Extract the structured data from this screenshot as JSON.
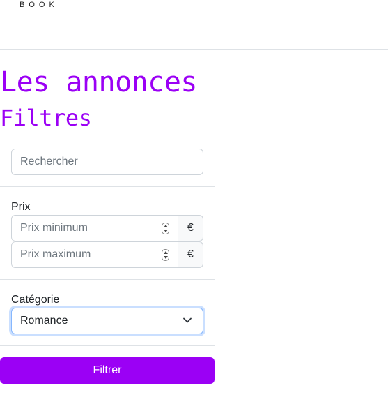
{
  "brand": {
    "text": "BOOK"
  },
  "page": {
    "title": "Les annonces",
    "filters_title": "Filtres"
  },
  "search": {
    "placeholder": "Rechercher"
  },
  "price": {
    "label": "Prix",
    "min_placeholder": "Prix minimum",
    "max_placeholder": "Prix maximum",
    "currency": "€"
  },
  "category": {
    "label": "Catégorie",
    "selected": "Romance"
  },
  "actions": {
    "filter_label": "Filtrer"
  },
  "colors": {
    "accent": "#9b00f5",
    "focus_ring": "#86b7fe"
  },
  "icons": {
    "select": "chevron-down-icon",
    "spinner": "spin-stepper-icon"
  }
}
